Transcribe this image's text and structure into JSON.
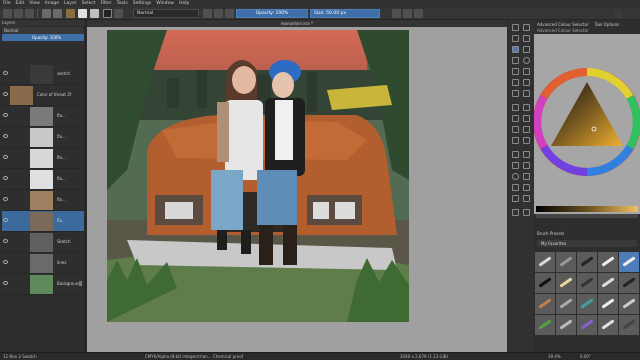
{
  "menu": [
    "File",
    "Edit",
    "View",
    "Image",
    "Layer",
    "Select",
    "Filter",
    "Tools",
    "Settings",
    "Window",
    "Help"
  ],
  "toolbar": {
    "blend_mode": "Normal",
    "opacity": "Opacity: 100%",
    "size": "Size: 50.00 px"
  },
  "left_dock": {
    "title": "Layers",
    "blend": "Normal",
    "opacity": "Opacity: 100%",
    "layers": [
      {
        "name": "sketch",
        "active": false
      },
      {
        "name": "Color of throat 2f",
        "active": false
      },
      {
        "name": "fla...",
        "active": false
      },
      {
        "name": "fla...",
        "active": false
      },
      {
        "name": "fla...",
        "active": false
      },
      {
        "name": "fla...",
        "active": false
      },
      {
        "name": "fla...",
        "active": false
      },
      {
        "name": "fla...",
        "active": false
      },
      {
        "name": "Sketch",
        "active": false
      },
      {
        "name": "lines",
        "active": false
      },
      {
        "name": "Background",
        "active": false
      }
    ],
    "footer": "12 Nov 2 Swatch"
  },
  "canvas": {
    "document_tab": "leanonhim.kra *"
  },
  "right_dock": {
    "tabs": [
      "Advanced Colour Selector",
      "Tool Options"
    ],
    "sub": "Advanced Colour Selector",
    "brush_presets_title": "Brush Presets",
    "tag": "My Favorites"
  },
  "status": {
    "left": "12 Nov 2 Swatch",
    "center": "CMYK/Alpha (8-bit integer/chan...   Chemical proof",
    "right": "2040 x 2,679 (1.13 GiB)",
    "zoom": "39.4%",
    "angle": "0.00°"
  },
  "colors": {
    "accent": "#3f6fa8",
    "panel": "#2e2e2e",
    "canvas_bg": "#a0a0a0"
  }
}
